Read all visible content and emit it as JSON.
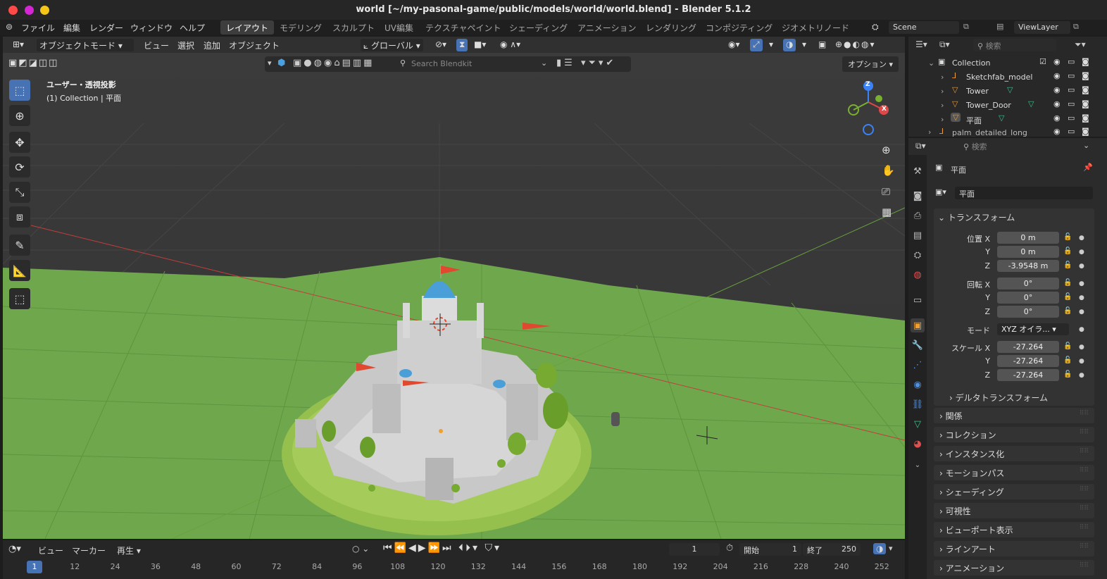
{
  "window": {
    "title": "world [~/my-pasonal-game/public/models/world/world.blend] - Blender 5.1.2"
  },
  "menu": {
    "items": [
      "ファイル",
      "編集",
      "レンダー",
      "ウィンドウ",
      "ヘルプ"
    ]
  },
  "workspaces": [
    "レイアウト",
    "モデリング",
    "スカルプト",
    "UV編集",
    "テクスチャペイント",
    "シェーディング",
    "アニメーション",
    "レンダリング",
    "コンポジティング",
    "ジオメトリノード"
  ],
  "scene": {
    "name": "Scene",
    "view_layer": "ViewLayer"
  },
  "viewport_header": {
    "mode": "オブジェクトモード",
    "menus": [
      "ビュー",
      "選択",
      "追加",
      "オブジェクト"
    ],
    "orientation": "グローバル",
    "options": "オプション",
    "search_placeholder": "Search Blendkit"
  },
  "viewport": {
    "view_name": "ユーザー・透視投影",
    "context": "(1) Collection | 平面"
  },
  "gizmo": {
    "z": "Z",
    "x": "X"
  },
  "timeline": {
    "menus": [
      "ビュー",
      "マーカー",
      "再生"
    ],
    "current_frame": "1",
    "start_label": "開始",
    "start": "1",
    "end_label": "終了",
    "end": "250",
    "frames": [
      "1",
      "12",
      "24",
      "36",
      "48",
      "60",
      "72",
      "84",
      "96",
      "108",
      "120",
      "132",
      "144",
      "156",
      "168",
      "180",
      "192",
      "204",
      "216",
      "228",
      "240",
      "252"
    ]
  },
  "outliner": {
    "search_placeholder": "検索",
    "collection": "Collection",
    "items": [
      {
        "name": "Sketchfab_model"
      },
      {
        "name": "Tower"
      },
      {
        "name": "Tower_Door"
      },
      {
        "name": "平面"
      },
      {
        "name": "palm_detailed_long"
      }
    ]
  },
  "properties": {
    "search_placeholder": "検索",
    "object_name": "平面",
    "data_name": "平面",
    "transform_title": "トランスフォーム",
    "location": {
      "label": "位置 X",
      "x": "0 m",
      "y": "0 m",
      "z": "-3.9548 m"
    },
    "rotation": {
      "label": "回転 X",
      "x": "0°",
      "y": "0°",
      "z": "0°"
    },
    "mode_label": "モード",
    "mode_value": "XYZ オイラ...",
    "scale": {
      "label": "スケール X",
      "x": "-27.264",
      "y": "-27.264",
      "z": "-27.264"
    },
    "axis_y": "Y",
    "axis_z": "Z",
    "delta": "デルタトランスフォーム",
    "panels": [
      "関係",
      "コレクション",
      "インスタンス化",
      "モーションパス",
      "シェーディング",
      "可視性",
      "ビューポート表示",
      "ラインアート",
      "アニメーション"
    ]
  },
  "colors": {
    "accent": "#4772b3",
    "ground": "#6fa84c",
    "dome": "#4a9fd8",
    "flag": "#e0482f"
  }
}
